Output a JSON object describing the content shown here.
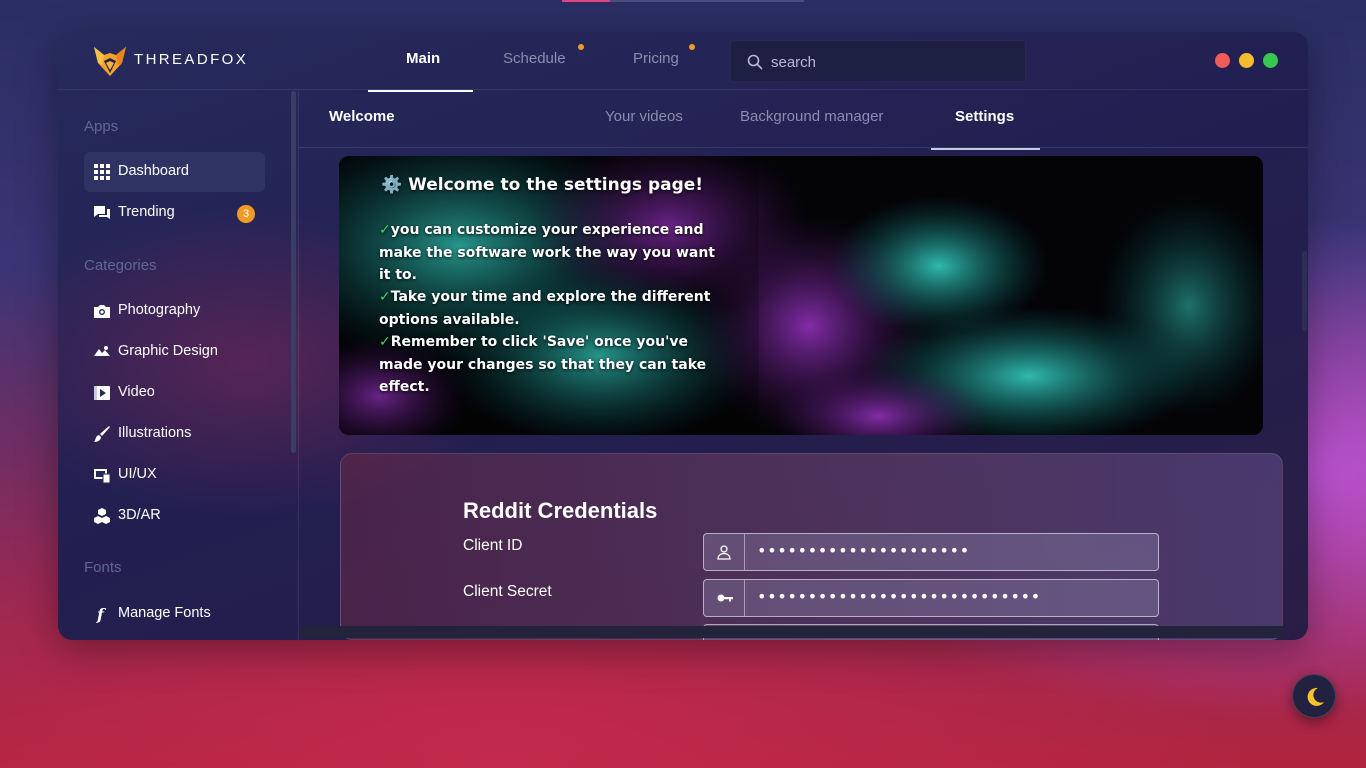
{
  "app": {
    "name": "THREADFOX"
  },
  "topnav": {
    "tabs": [
      {
        "label": "Main",
        "active": true
      },
      {
        "label": "Schedule",
        "dot": true
      },
      {
        "label": "Pricing",
        "dot": true
      }
    ],
    "search_placeholder": "search"
  },
  "window_controls": {
    "colors": [
      "#f05a57",
      "#f5bd2e",
      "#37c84f"
    ]
  },
  "sidebar": {
    "sections": [
      {
        "label": "Apps"
      },
      {
        "label": "Categories"
      },
      {
        "label": "Fonts"
      }
    ],
    "apps": [
      {
        "label": "Dashboard",
        "icon": "grid-icon",
        "active": true
      },
      {
        "label": "Trending",
        "icon": "chat-icon",
        "badge": "3"
      }
    ],
    "categories": [
      {
        "label": "Photography",
        "icon": "camera-icon"
      },
      {
        "label": "Graphic Design",
        "icon": "palette-icon"
      },
      {
        "label": "Video",
        "icon": "video-icon"
      },
      {
        "label": "Illustrations",
        "icon": "brush-icon"
      },
      {
        "label": "UI/UX",
        "icon": "ui-icon"
      },
      {
        "label": "3D/AR",
        "icon": "cubes-icon"
      }
    ],
    "fonts": [
      {
        "label": "Manage Fonts",
        "icon": "font-icon"
      }
    ]
  },
  "subtabs": [
    {
      "label": "Welcome"
    },
    {
      "label": "Your videos"
    },
    {
      "label": "Background manager"
    },
    {
      "label": "Settings",
      "active": true
    }
  ],
  "hero": {
    "title": "⚙️ Welcome to the settings page!",
    "lines": [
      "you can customize your experience and make the software work the way you want it to.",
      "Take your time and explore the different options available.",
      "Remember to click 'Save' once you've made your changes so that they can take effect."
    ],
    "check": "✓"
  },
  "credentials": {
    "title": "Reddit Credentials",
    "fields": [
      {
        "label": "Client ID",
        "icon": "user-icon",
        "value": "•••••••••••••••••••••"
      },
      {
        "label": "Client Secret",
        "icon": "key-icon",
        "value": "••••••••••••••••••••••••••••"
      }
    ]
  },
  "theme": {
    "accent": "#f39a24",
    "night_icon": "moon-icon"
  }
}
